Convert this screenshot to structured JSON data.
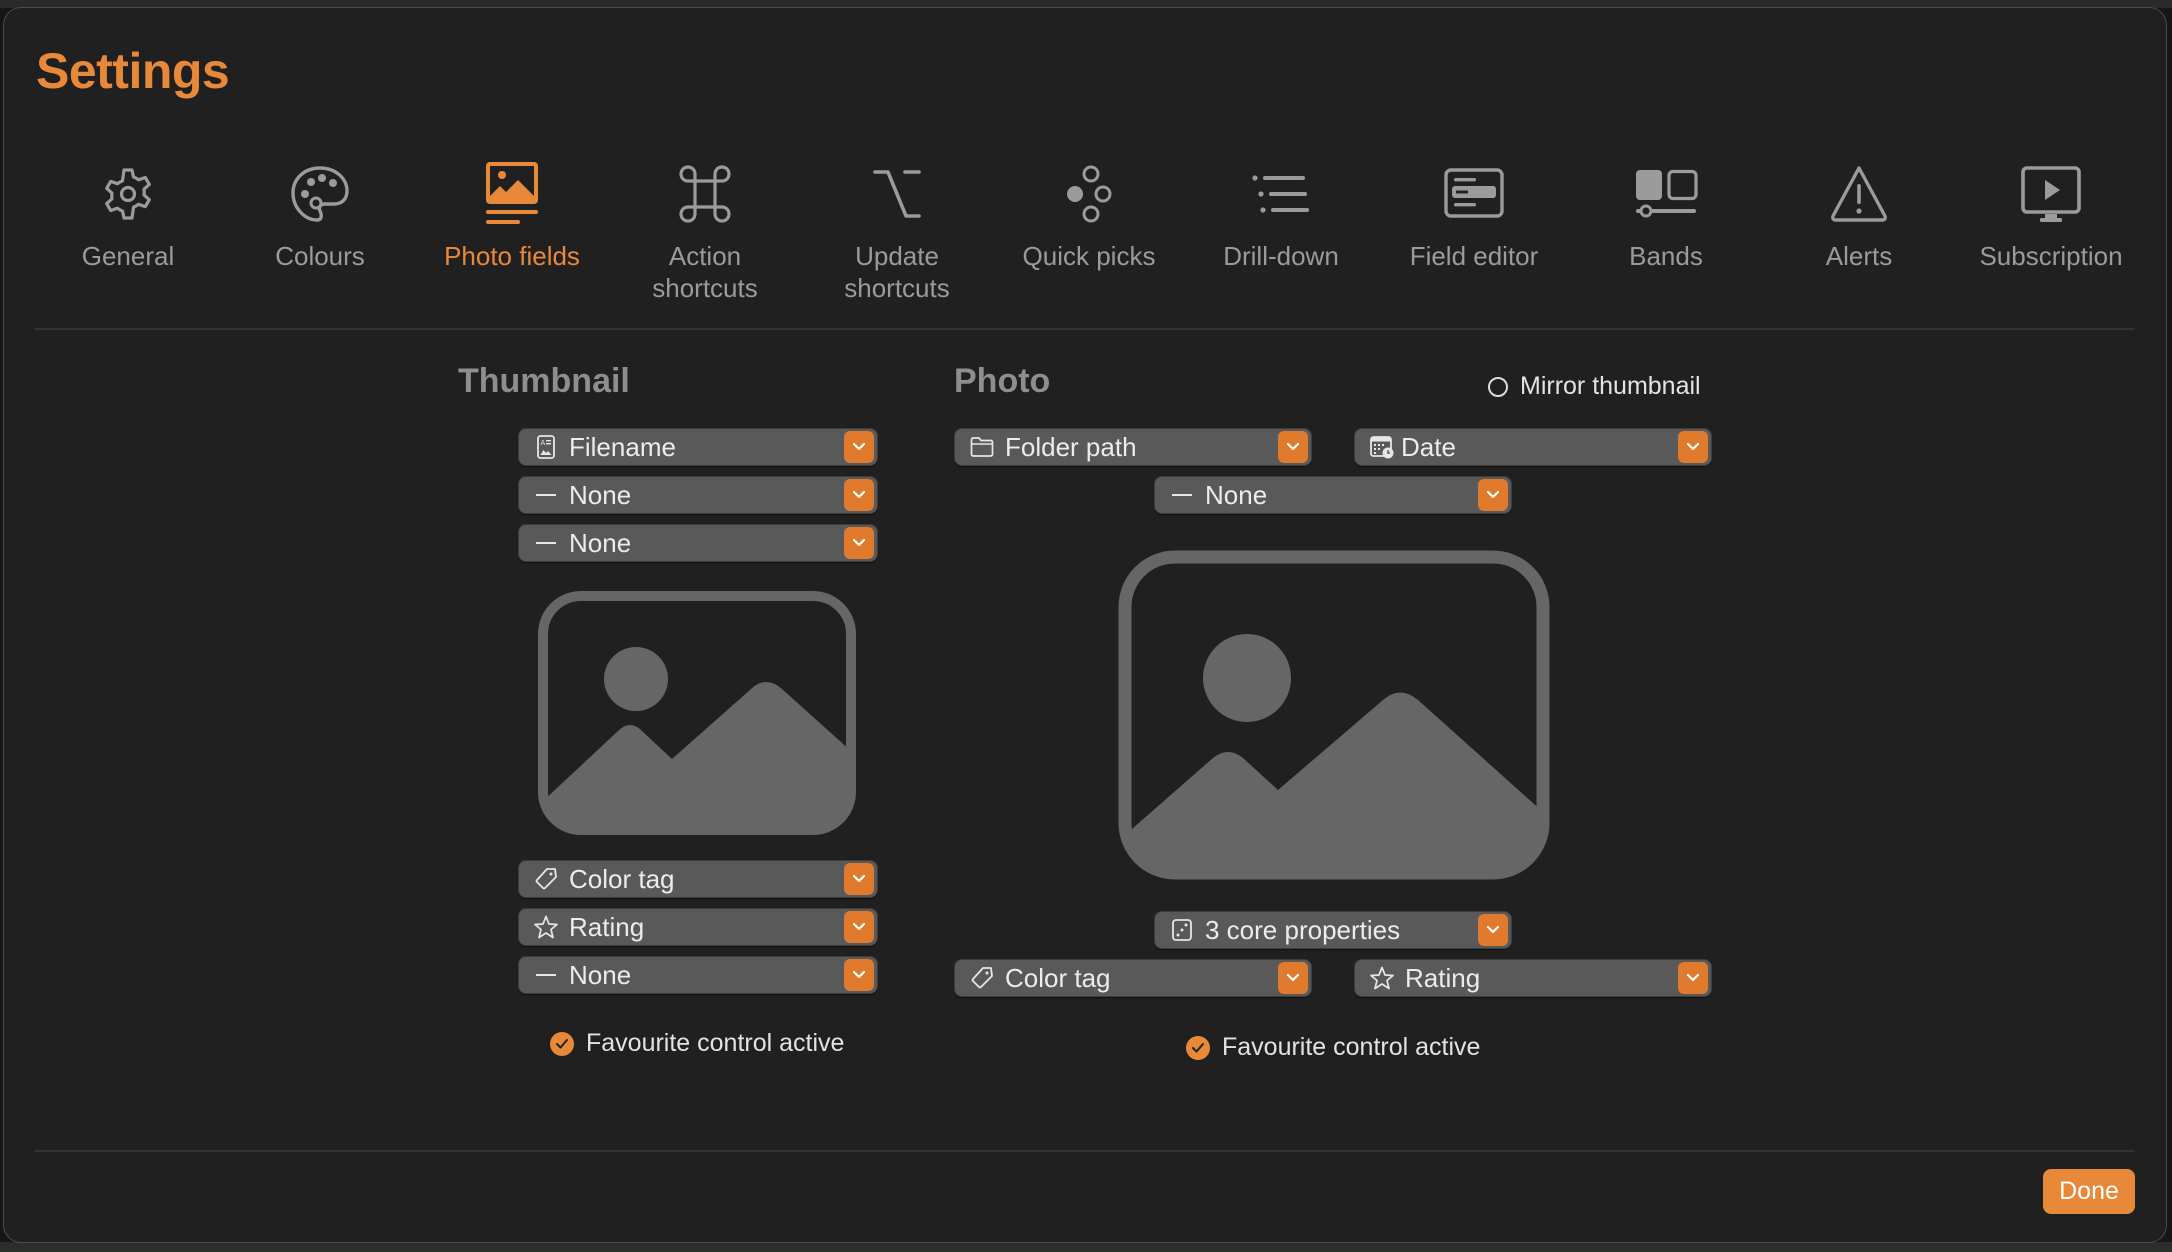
{
  "window": {
    "title": "Settings"
  },
  "colors": {
    "accent": "#E8893A",
    "chevron_bg": "#E07A2C",
    "tab_inactive": "#9b9b9b",
    "dropdown_bg": "#595959",
    "window_bg": "#202020",
    "placeholder": "#666666"
  },
  "tabs": [
    {
      "id": "general",
      "label": "General",
      "icon": "gear-icon",
      "active": false
    },
    {
      "id": "colours",
      "label": "Colours",
      "icon": "palette-icon",
      "active": false
    },
    {
      "id": "photo-fields",
      "label": "Photo fields",
      "icon": "photo-fields-icon",
      "active": true
    },
    {
      "id": "action-shortcuts",
      "label": "Action shortcuts",
      "label_lines": [
        "Action",
        "shortcuts"
      ],
      "icon": "command-icon",
      "active": false
    },
    {
      "id": "update-shortcuts",
      "label": "Update shortcuts",
      "label_lines": [
        "Update",
        "shortcuts"
      ],
      "icon": "option-key-icon",
      "active": false
    },
    {
      "id": "quick-picks",
      "label": "Quick picks",
      "icon": "quick-picks-icon",
      "active": false
    },
    {
      "id": "drill-down",
      "label": "Drill-down",
      "icon": "list-indent-icon",
      "active": false
    },
    {
      "id": "field-editor",
      "label": "Field editor",
      "icon": "field-editor-icon",
      "active": false
    },
    {
      "id": "bands",
      "label": "Bands",
      "icon": "bands-icon",
      "active": false
    },
    {
      "id": "alerts",
      "label": "Alerts",
      "icon": "warning-triangle-icon",
      "active": false
    },
    {
      "id": "subscription",
      "label": "Subscription",
      "icon": "display-play-icon",
      "active": false
    }
  ],
  "thumbnail": {
    "heading": "Thumbnail",
    "top_fields": [
      {
        "value": "Filename",
        "icon": "filename-icon"
      },
      {
        "value": "None",
        "icon": "dash-icon"
      },
      {
        "value": "None",
        "icon": "dash-icon"
      }
    ],
    "bottom_fields": [
      {
        "value": "Color tag",
        "icon": "tag-icon"
      },
      {
        "value": "Rating",
        "icon": "star-icon"
      },
      {
        "value": "None",
        "icon": "dash-icon"
      }
    ],
    "favourite": {
      "label": "Favourite control active",
      "checked": true
    }
  },
  "photo": {
    "heading": "Photo",
    "mirror": {
      "label": "Mirror thumbnail",
      "checked": false
    },
    "top_left": {
      "value": "Folder path",
      "icon": "folder-icon"
    },
    "top_right": {
      "value": "Date",
      "icon": "calendar-clock-icon"
    },
    "top_center": {
      "value": "None",
      "icon": "dash-icon"
    },
    "bottom_center": {
      "value": "3 core properties",
      "icon": "dice-icon"
    },
    "bottom_left": {
      "value": "Color tag",
      "icon": "tag-icon"
    },
    "bottom_right": {
      "value": "Rating",
      "icon": "star-icon"
    },
    "favourite": {
      "label": "Favourite control active",
      "checked": true
    }
  },
  "footer": {
    "done_label": "Done"
  }
}
